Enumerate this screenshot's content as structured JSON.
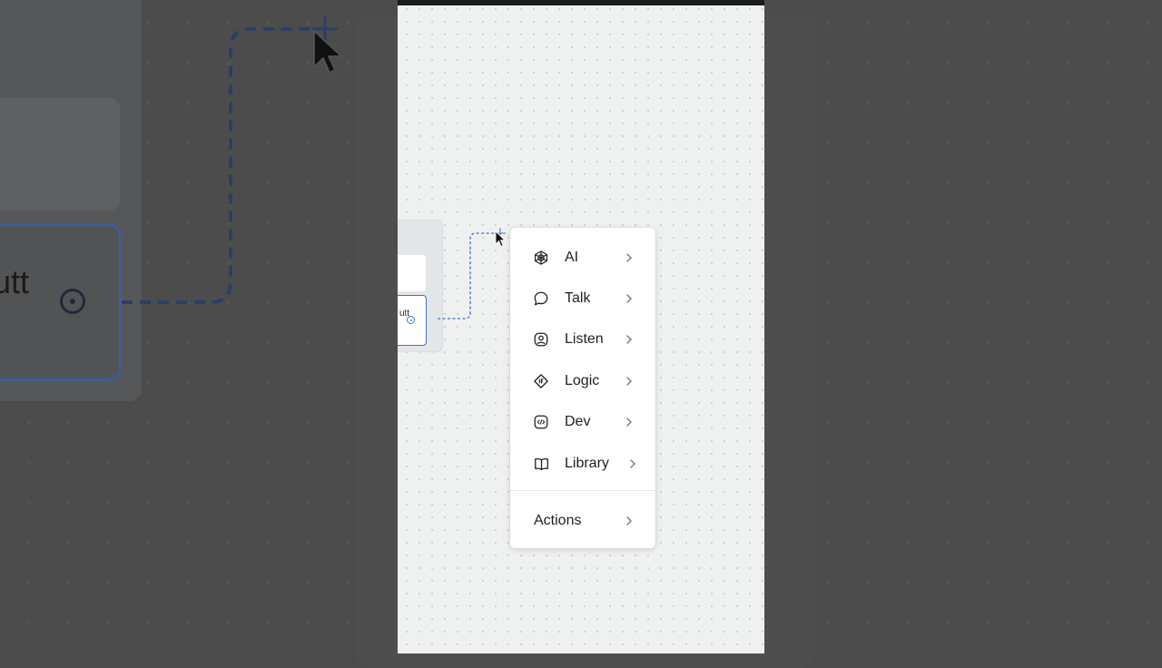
{
  "background": {
    "node_option_label": "utt"
  },
  "canvas": {
    "node": {
      "option_label": "utt"
    }
  },
  "menu": {
    "items": [
      {
        "label": "AI",
        "icon": "ai-icon"
      },
      {
        "label": "Talk",
        "icon": "talk-icon"
      },
      {
        "label": "Listen",
        "icon": "listen-icon"
      },
      {
        "label": "Logic",
        "icon": "logic-icon"
      },
      {
        "label": "Dev",
        "icon": "dev-icon"
      },
      {
        "label": "Library",
        "icon": "library-icon"
      }
    ],
    "actions_label": "Actions"
  },
  "colors": {
    "accent": "#3f72c4",
    "canvas_bg": "#eff1f1",
    "menu_bg": "#ffffff",
    "text": "#1e1f22"
  }
}
